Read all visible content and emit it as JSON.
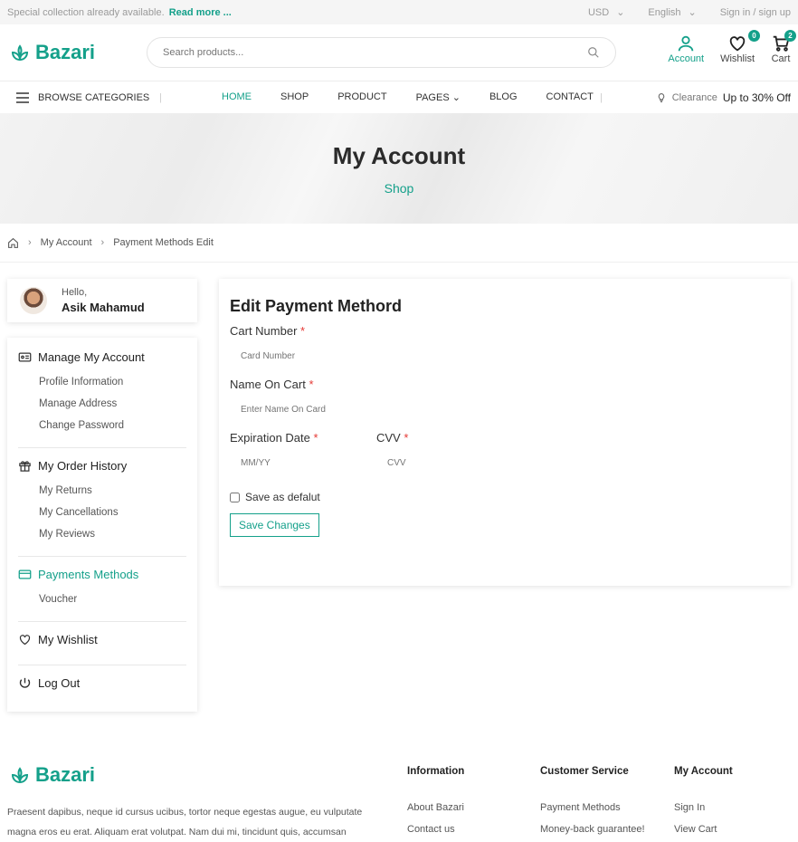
{
  "topbar": {
    "promo_text": "Special collection already available.",
    "promo_link": "Read more ...",
    "currency": "USD",
    "language": "English",
    "auth": "Sign in / sign up"
  },
  "header": {
    "logo": "Bazari",
    "search_placeholder": "Search products...",
    "account_label": "Account",
    "wishlist_label": "Wishlist",
    "wishlist_count": "0",
    "cart_label": "Cart",
    "cart_count": "2"
  },
  "nav": {
    "browse": "BROWSE CATEGORIES",
    "items": [
      "HOME",
      "SHOP",
      "PRODUCT",
      "PAGES",
      "BLOG",
      "CONTACT"
    ],
    "clearance_label": "Clearance",
    "clearance_offer": "Up to 30% Off"
  },
  "hero": {
    "title": "My Account",
    "subtitle": "Shop"
  },
  "breadcrumb": [
    "My Account",
    "Payment Methods Edit"
  ],
  "sidebar": {
    "hello": "Hello,",
    "name": "Asik Mahamud",
    "groups": [
      {
        "title": "Manage My Account",
        "items": [
          "Profile Information",
          "Manage Address",
          "Change Password"
        ]
      },
      {
        "title": "My Order History",
        "items": [
          "My Returns",
          "My Cancellations",
          "My Reviews"
        ]
      },
      {
        "title": "Payments Methods",
        "items": [
          "Voucher"
        ]
      },
      {
        "title": "My Wishlist",
        "items": []
      },
      {
        "title": "Log Out",
        "items": []
      }
    ]
  },
  "form": {
    "title": "Edit Payment Methord",
    "card_number_label": "Cart Number",
    "card_number_placeholder": "Card Number",
    "name_label": "Name On Cart",
    "name_placeholder": "Enter Name On Card",
    "exp_label": "Expiration Date",
    "exp_placeholder": "MM/YY",
    "cvv_label": "CVV",
    "cvv_placeholder": "CVV",
    "required_mark": "*",
    "save_default": "Save as defalut",
    "save_button": "Save Changes"
  },
  "footer": {
    "logo": "Bazari",
    "desc_line1": "Praesent dapibus, neque id cursus ucibus, tortor neque egestas augue, eu vulputate",
    "desc_line2": "magna eros eu erat. Aliquam erat volutpat. Nam dui mi, tincidunt quis, accumsan",
    "cols": [
      {
        "title": "Information",
        "items": [
          "About Bazari",
          "Contact us"
        ]
      },
      {
        "title": "Customer Service",
        "items": [
          "Payment Methods",
          "Money-back guarantee!"
        ]
      },
      {
        "title": "My Account",
        "items": [
          "Sign In",
          "View Cart"
        ]
      }
    ]
  },
  "colors": {
    "accent": "#14a08a",
    "required": "#e53935"
  }
}
